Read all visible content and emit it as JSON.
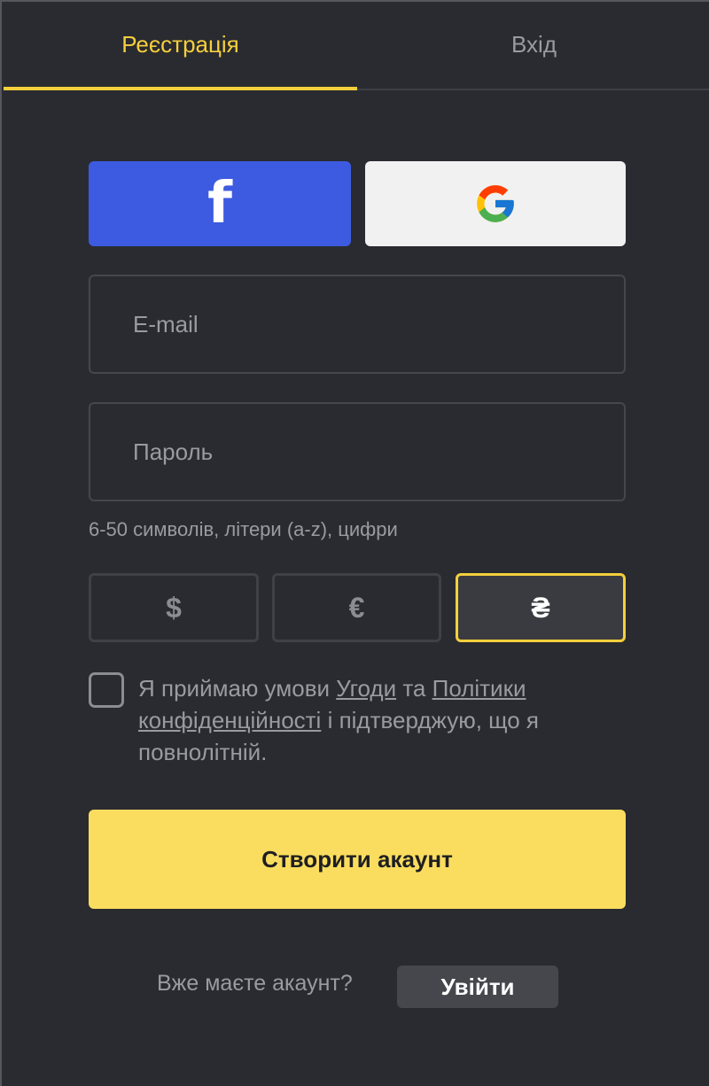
{
  "tabs": [
    {
      "label": "Реєстрація",
      "active": true
    },
    {
      "label": "Вхід",
      "active": false
    }
  ],
  "social": {
    "facebook_icon": "facebook-icon",
    "facebook_glyph": "f",
    "google_icon": "google-icon"
  },
  "form": {
    "email_placeholder": "E-mail",
    "password_placeholder": "Пароль",
    "password_hint": "6-50 символів, літери (a-z), цифри"
  },
  "currencies": [
    {
      "symbol": "$",
      "selected": false
    },
    {
      "symbol": "€",
      "selected": false
    },
    {
      "symbol": "₴",
      "selected": true
    }
  ],
  "terms": {
    "checked": false,
    "text_1": "Я приймаю умови ",
    "link_agreement": "Угоди",
    "text_2": " та ",
    "link_privacy": "Політики конфіденційності",
    "text_3": " і підтверджую, що я повнолітній."
  },
  "create_button": "Створити акаунт",
  "footer": {
    "have_account": "Вже маєте акаунт?",
    "login_button": "Увійти"
  },
  "colors": {
    "accent": "#f5cf3c",
    "primary_button": "#fadd5e",
    "facebook": "#3d5be0",
    "background": "#2a2b30"
  }
}
